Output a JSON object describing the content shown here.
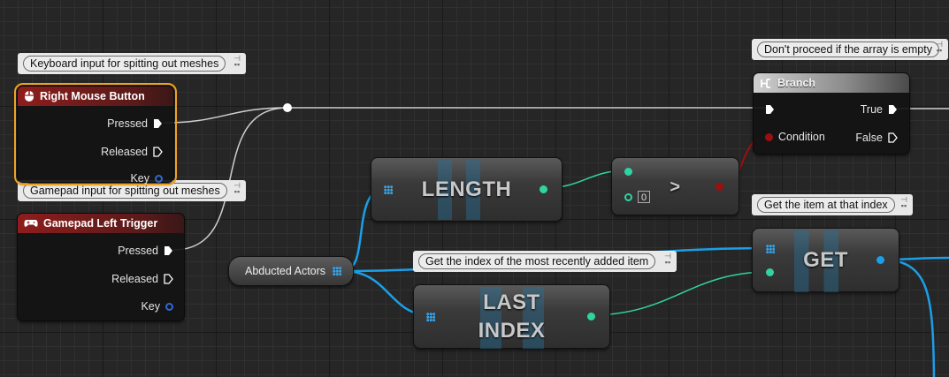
{
  "colors": {
    "exec_wire": "#cfcfcf",
    "array_wire": "#1a9fe8",
    "int_wire": "#2fd4a2",
    "bool_wire": "#9a1010",
    "selected_outline": "#f0a21f"
  },
  "comments": {
    "keyboard": "Keyboard input for spitting out meshes",
    "gamepad": "Gamepad input for spitting out meshes",
    "branch": "Don't proceed if the array is empty",
    "get": "Get the item at that index",
    "last_index": "Get the index of the most recently added item"
  },
  "rmb_node": {
    "title": "Right Mouse Button",
    "icon": "mouse-icon",
    "pins": {
      "pressed": "Pressed",
      "released": "Released",
      "key": "Key"
    }
  },
  "gamepad_node": {
    "title": "Gamepad Left Trigger",
    "icon": "gamepad-icon",
    "pins": {
      "pressed": "Pressed",
      "released": "Released",
      "key": "Key"
    }
  },
  "variable_node": {
    "label": "Abducted Actors"
  },
  "length_node": {
    "label": "LENGTH"
  },
  "compare_node": {
    "operator": ">",
    "value": "0"
  },
  "last_index_node": {
    "line1": "LAST",
    "line2": "INDEX"
  },
  "get_node": {
    "label": "GET"
  },
  "branch_node": {
    "title": "Branch",
    "icon": "branch-icon",
    "pins": {
      "condition": "Condition",
      "true": "True",
      "false": "False"
    }
  }
}
